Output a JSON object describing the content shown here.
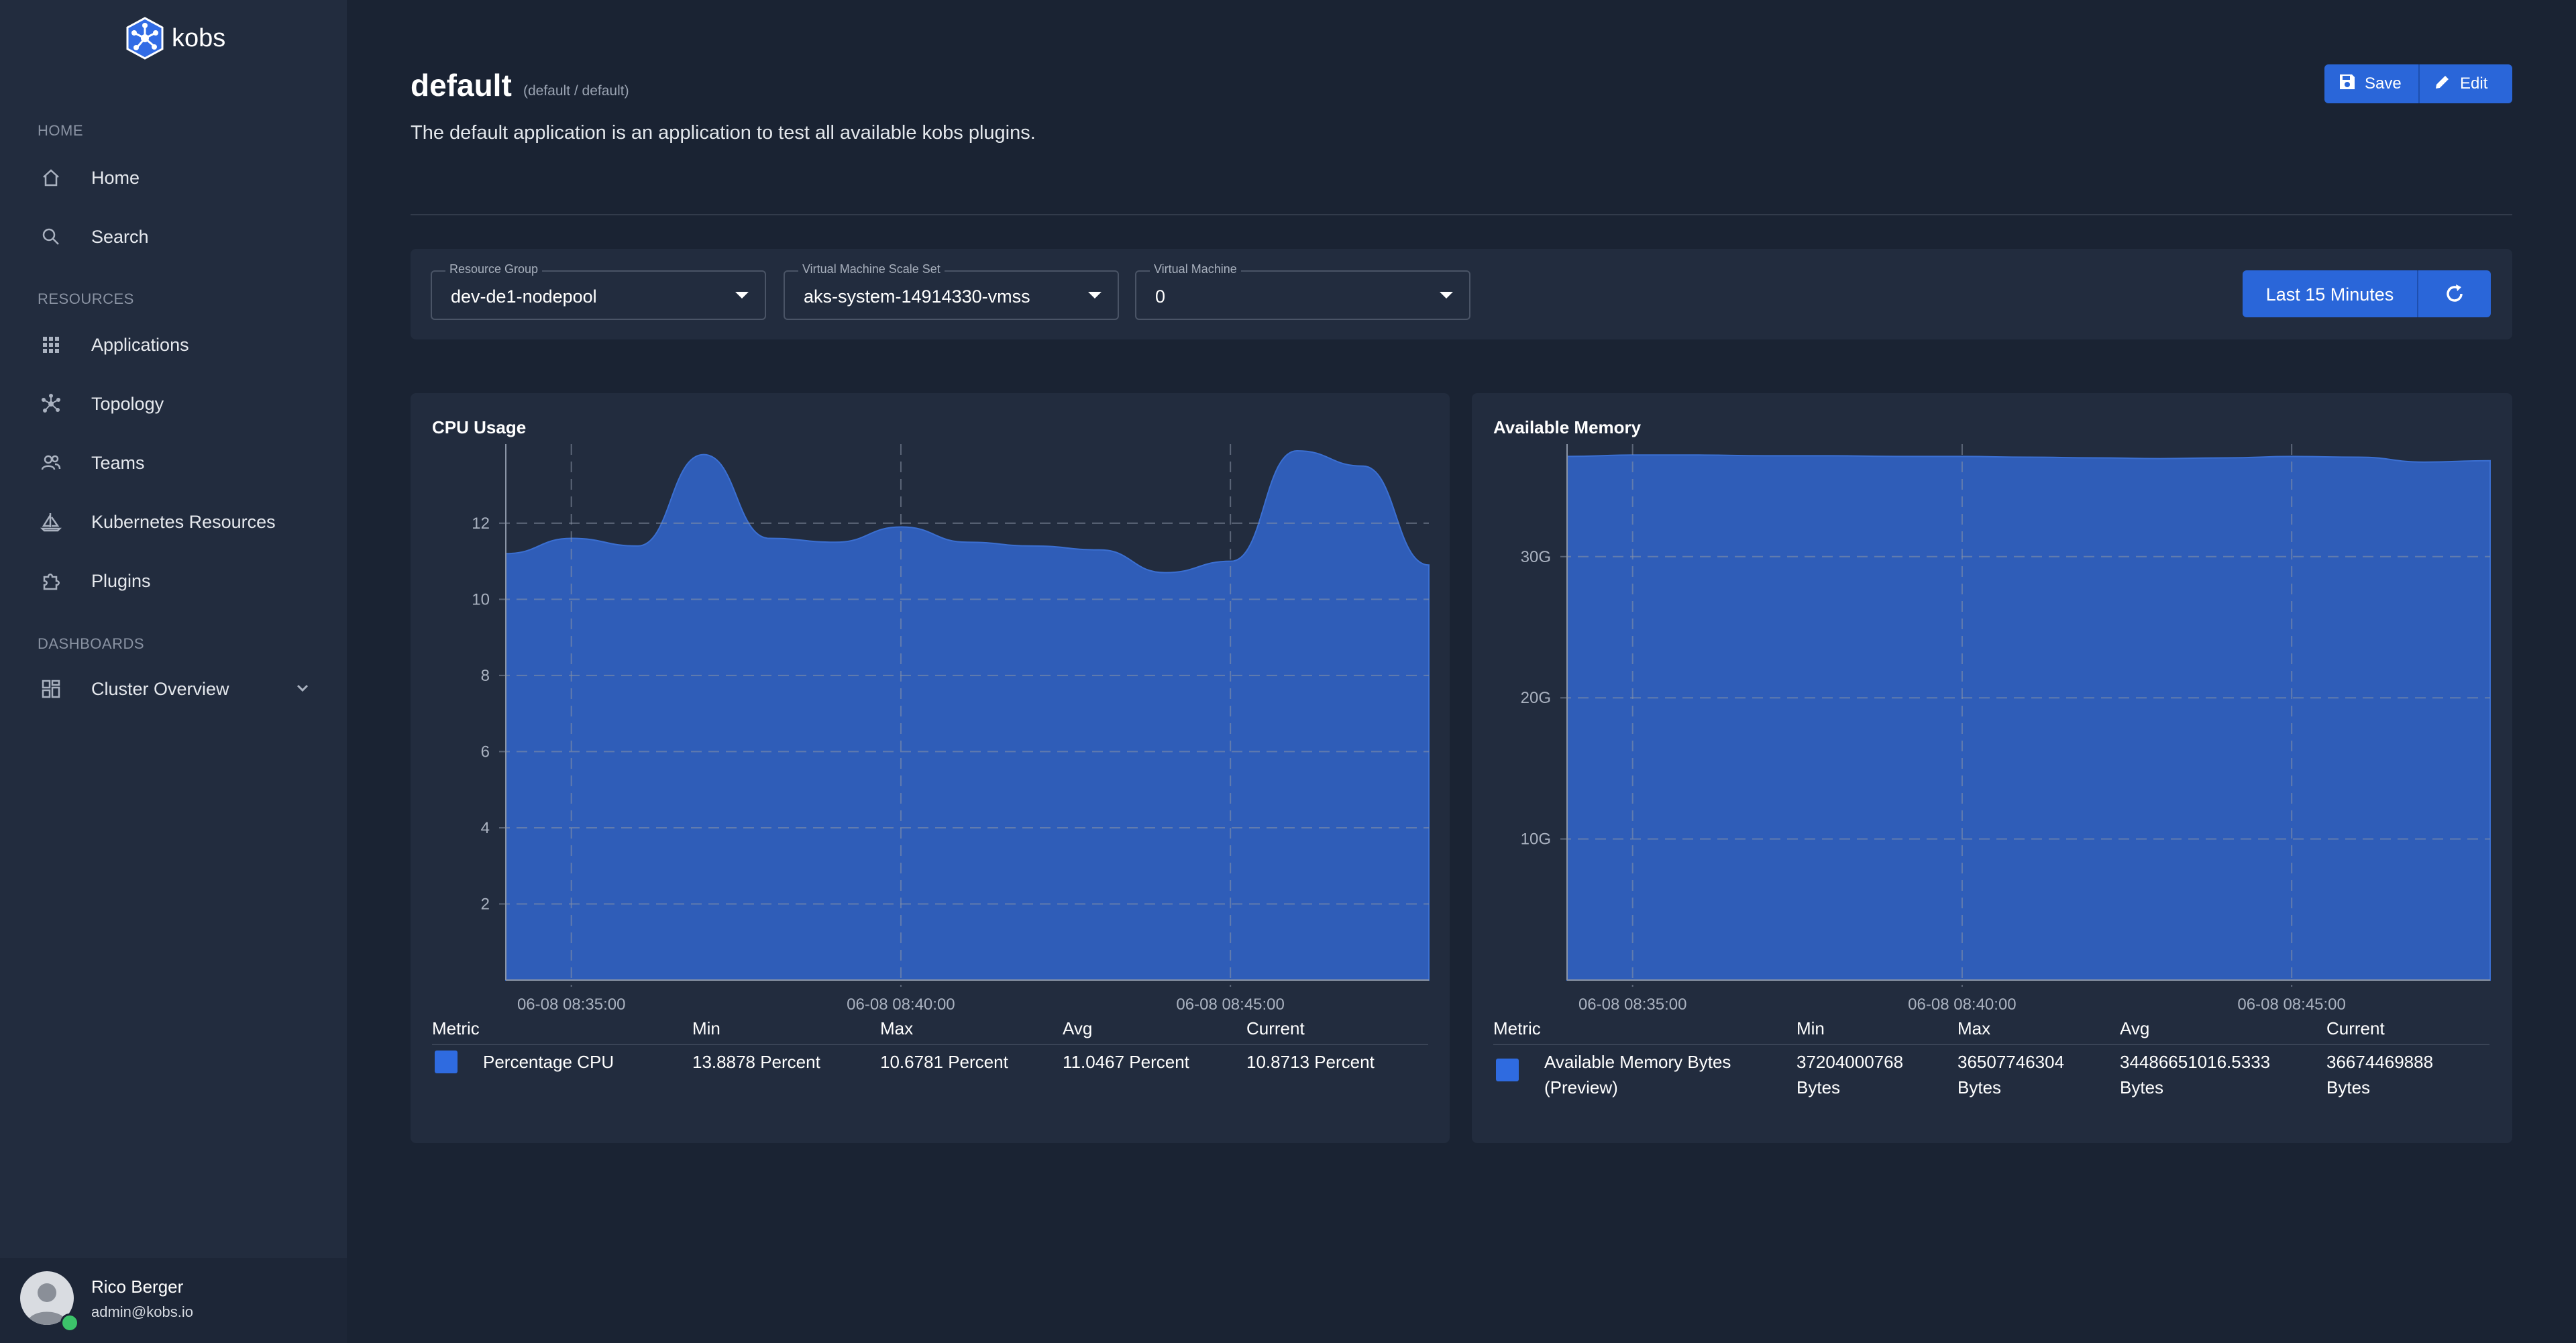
{
  "app": {
    "name": "kobs"
  },
  "sidebar": {
    "sections": [
      {
        "label": "HOME"
      },
      {
        "label": "RESOURCES"
      },
      {
        "label": "DASHBOARDS"
      }
    ],
    "items": [
      {
        "label": "Home",
        "icon": "home-icon"
      },
      {
        "label": "Search",
        "icon": "search-icon"
      },
      {
        "label": "Applications",
        "icon": "grid-icon"
      },
      {
        "label": "Topology",
        "icon": "topology-icon"
      },
      {
        "label": "Teams",
        "icon": "users-icon"
      },
      {
        "label": "Kubernetes Resources",
        "icon": "helm-icon"
      },
      {
        "label": "Plugins",
        "icon": "puzzle-icon"
      },
      {
        "label": "Cluster Overview",
        "icon": "dashboard-icon"
      }
    ],
    "user": {
      "name": "Rico Berger",
      "email": "admin@kobs.io",
      "status_color": "#3cc36a"
    }
  },
  "header": {
    "title": "default",
    "subtitle": "(default / default)",
    "description": "The default application is an application to test all available kobs plugins.",
    "save_label": "Save",
    "edit_label": "Edit"
  },
  "filters": {
    "resource_group": {
      "label": "Resource Group",
      "value": "dev-de1-nodepool"
    },
    "vmss": {
      "label": "Virtual Machine Scale Set",
      "value": "aks-system-14914330-vmss"
    },
    "vm": {
      "label": "Virtual Machine",
      "value": "0"
    },
    "time_range": "Last 15 Minutes"
  },
  "colors": {
    "accent": "#2a66d9",
    "series": "#2f5db8",
    "background": "#1a2333",
    "panel": "#222c3e"
  },
  "legend_headers": [
    "Metric",
    "Min",
    "Max",
    "Avg",
    "Current"
  ],
  "cpu_legend": {
    "metric": "Percentage CPU",
    "min": "13.8878 Percent",
    "max": "10.6781 Percent",
    "avg": "11.0467 Percent",
    "current": "10.8713 Percent"
  },
  "mem_legend": {
    "metric_line1": "Available Memory Bytes",
    "metric_line2": "(Preview)",
    "min_line1": "37204000768",
    "max_line1": "36507746304",
    "avg_line1": "34486651016.5333",
    "current_line1": "36674469888",
    "unit": "Bytes"
  },
  "chart_data": [
    {
      "type": "area",
      "title": "CPU Usage",
      "ylim": [
        0,
        13.9
      ],
      "yticks": [
        2,
        4,
        6,
        8,
        10,
        12
      ],
      "xticks": [
        "06-08 08:35:00",
        "06-08 08:40:00",
        "06-08 08:45:00"
      ],
      "x": [
        0,
        1,
        2,
        3,
        4,
        5,
        6,
        7,
        8,
        9,
        10,
        11,
        12,
        13,
        14
      ],
      "series": [
        {
          "name": "Percentage CPU",
          "values": [
            11.2,
            11.6,
            11.4,
            13.8,
            11.6,
            11.5,
            11.9,
            11.5,
            11.4,
            11.3,
            10.7,
            11.0,
            13.9,
            13.5,
            10.9
          ]
        }
      ],
      "grid": true
    },
    {
      "type": "area",
      "title": "Available Memory",
      "ylim": [
        0,
        37.5
      ],
      "yticks": [
        "10G",
        "20G",
        "30G"
      ],
      "ytick_values": [
        10,
        20,
        30
      ],
      "xticks": [
        "06-08 08:35:00",
        "06-08 08:40:00",
        "06-08 08:45:00"
      ],
      "x": [
        0,
        1,
        2,
        3,
        4,
        5,
        6,
        7,
        8,
        9,
        10,
        11,
        12,
        13,
        14
      ],
      "series": [
        {
          "name": "Available Memory Bytes (Preview)",
          "values": [
            37.1,
            37.2,
            37.2,
            37.15,
            37.15,
            37.1,
            37.1,
            37.05,
            37.0,
            36.95,
            37.0,
            37.1,
            37.05,
            36.7,
            36.8
          ]
        }
      ],
      "grid": true
    }
  ]
}
